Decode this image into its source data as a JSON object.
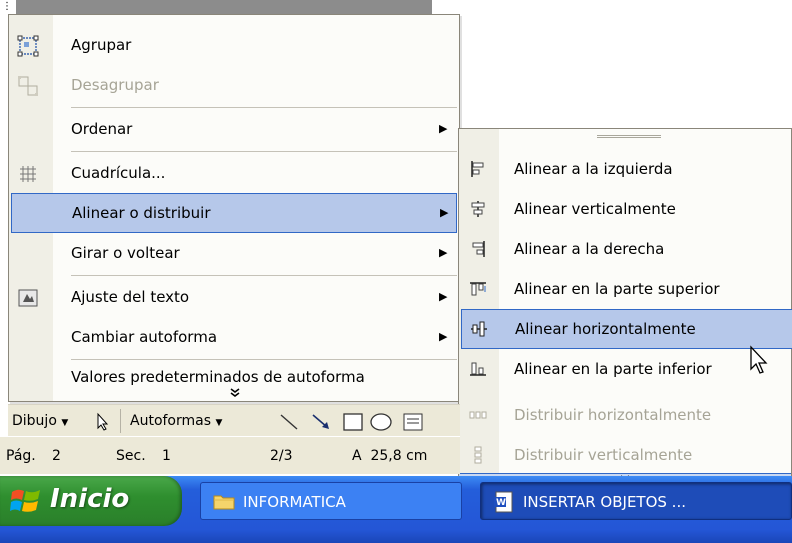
{
  "menu": {
    "items": [
      {
        "label": "Agrupar",
        "icon": "group-icon",
        "disabled": false,
        "submenu": false
      },
      {
        "label": "Desagrupar",
        "icon": "ungroup-icon",
        "disabled": true,
        "submenu": false
      },
      {
        "label": "Ordenar",
        "icon": "",
        "disabled": false,
        "submenu": true
      },
      {
        "label": "Cuadrícula...",
        "icon": "grid-icon",
        "disabled": false,
        "submenu": false
      },
      {
        "label": "Alinear o distribuir",
        "icon": "",
        "disabled": false,
        "submenu": true,
        "highlighted": true
      },
      {
        "label": "Girar o voltear",
        "icon": "",
        "disabled": false,
        "submenu": true
      },
      {
        "label": "Ajuste del texto",
        "icon": "text-wrap-icon",
        "disabled": false,
        "submenu": true
      },
      {
        "label": "Cambiar autoforma",
        "icon": "",
        "disabled": false,
        "submenu": true
      },
      {
        "label": "Valores predeterminados de autoforma",
        "icon": "",
        "disabled": false,
        "submenu": false
      }
    ],
    "expand_glyph": "»"
  },
  "submenu": {
    "items": [
      {
        "label": "Alinear a la izquierda",
        "icon": "align-left-icon",
        "disabled": false
      },
      {
        "label": "Alinear verticalmente",
        "icon": "align-center-icon",
        "disabled": false
      },
      {
        "label": "Alinear a la derecha",
        "icon": "align-right-icon",
        "disabled": false
      },
      {
        "label": "Alinear en la parte superior",
        "icon": "align-top-icon",
        "disabled": false
      },
      {
        "label": "Alinear horizontalmente",
        "icon": "align-middle-icon",
        "disabled": false,
        "highlighted": true
      },
      {
        "label": "Alinear en la parte inferior",
        "icon": "align-bottom-icon",
        "disabled": false
      },
      {
        "label": "Distribuir horizontalmente",
        "icon": "distribute-horizontal-icon",
        "disabled": true
      },
      {
        "label": "Distribuir verticalmente",
        "icon": "distribute-vertical-icon",
        "disabled": true
      }
    ],
    "expand_glyph": "»"
  },
  "toolbar": {
    "draw_label": "Dibujo",
    "autoshapes_label": "Autoformas"
  },
  "status": {
    "page": "Pág.",
    "page_num": "2",
    "section": "Sec.",
    "section_num": "1",
    "fraction": "2/3",
    "position": "A  25,8 cm"
  },
  "taskbar": {
    "start_label": "Inicio",
    "task1_label": "INFORMATICA",
    "task2_label": "INSERTAR OBJETOS ..."
  },
  "colors": {
    "highlight": "#b6c8ea",
    "highlight_border": "#3168c6",
    "taskbar": "#245edb",
    "start": "#2f8f2f"
  }
}
